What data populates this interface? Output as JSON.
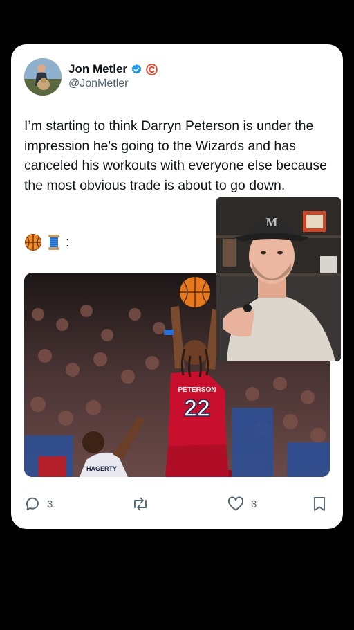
{
  "author": {
    "name": "Jon Metler",
    "handle": "@JonMetler",
    "verified_color": "#1d9bf0",
    "org_badge_color": "#e8452c"
  },
  "tweet": {
    "text": "I’m starting to think Darryn Peterson is under the impression he's going to the Wizards and has canceled his workouts with everyone else because the most obvious trade is about to go down.",
    "emoji_suffix": ":"
  },
  "media": {
    "main_jersey_name": "PETERSON",
    "main_jersey_number": "22",
    "defender_jersey_name": "HAGERTY",
    "main_jersey_color": "#c8102e"
  },
  "actions": {
    "reply_count": "3",
    "like_count": "3"
  },
  "overlay": {
    "cap_logo": "M"
  }
}
